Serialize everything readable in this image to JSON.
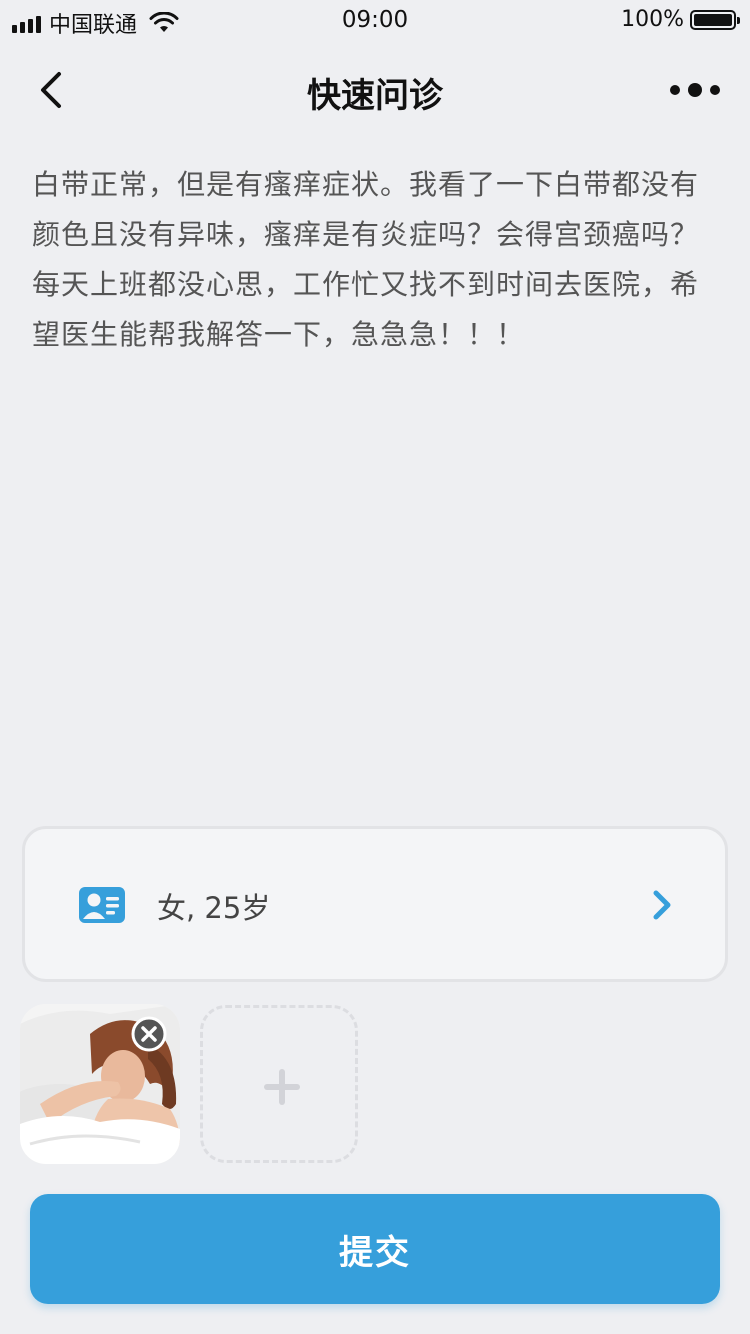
{
  "status_bar": {
    "carrier": "中国联通",
    "time": "09:00",
    "battery": "100%"
  },
  "nav": {
    "title": "快速问诊",
    "back_icon": "chevron-left-icon",
    "more_icon": "more-dots-icon"
  },
  "question": {
    "text": "白带正常，但是有瘙痒症状。我看了一下白带都没有颜色且没有异味，瘙痒是有炎症吗？会得宫颈癌吗？每天上班都没心思，工作忙又找不到时间去医院，希望医生能帮我解答一下，急急急！！！"
  },
  "profile": {
    "text": "女, 25岁",
    "icon": "id-card-icon"
  },
  "photos": {
    "add_icon": "plus-icon",
    "remove_icon": "close-circle-icon"
  },
  "submit": {
    "label": "提交"
  },
  "colors": {
    "accent": "#369fdb",
    "background": "#eeeff2"
  }
}
